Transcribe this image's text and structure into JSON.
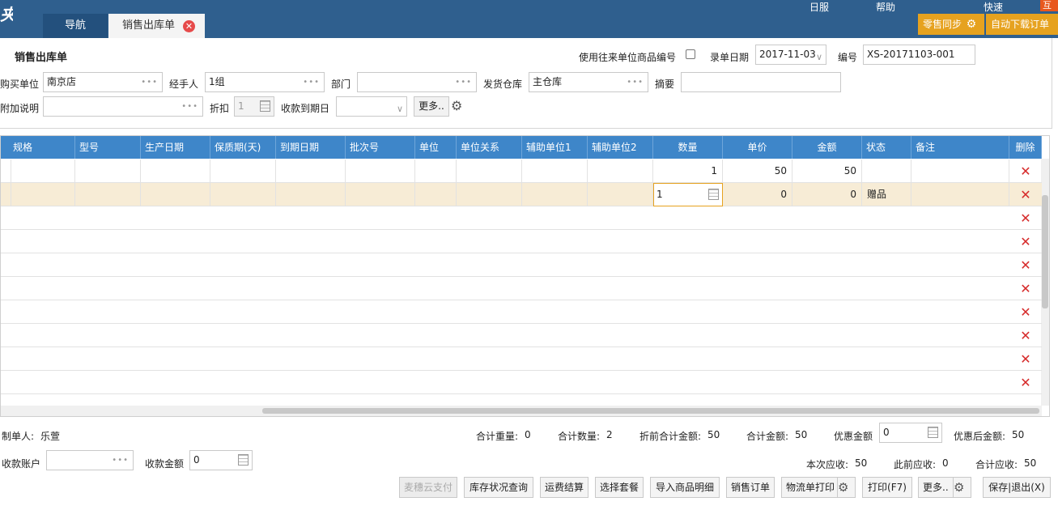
{
  "topbar": {
    "logo_fragment": "夹",
    "menu_fragments": [
      "日服",
      "帮助",
      "快速"
    ],
    "corner_tag": "互动",
    "tabs": [
      {
        "label": "导航"
      },
      {
        "label": "销售出库单"
      }
    ],
    "retail_sync_label": "零售同步",
    "auto_download_label": "自动下载订单"
  },
  "form": {
    "title": "销售出库单",
    "use_partner_code_label": "使用往来单位商品编号",
    "entry_date_label": "录单日期",
    "entry_date_value": "2017-11-03",
    "number_label": "编号",
    "number_value": "XS-20171103-001",
    "buyer_label": "购买单位",
    "buyer_value": "南京店",
    "handler_label": "经手人",
    "handler_value": "1组",
    "dept_label": "部门",
    "dept_value": "",
    "warehouse_label": "发货仓库",
    "warehouse_value": "主仓库",
    "summary_label": "摘要",
    "summary_value": "",
    "note_label": "附加说明",
    "note_value": "",
    "discount_label": "折扣",
    "discount_value": "1",
    "due_label": "收款到期日",
    "due_value": "",
    "more_label": "更多.."
  },
  "grid": {
    "columns": [
      "规格",
      "型号",
      "生产日期",
      "保质期(天)",
      "到期日期",
      "批次号",
      "单位",
      "单位关系",
      "辅助单位1",
      "辅助单位2",
      "数量",
      "单价",
      "金额",
      "状态",
      "备注",
      "删除"
    ],
    "rows": [
      {
        "qty": "1",
        "price": "50",
        "amount": "50",
        "status": ""
      },
      {
        "qty": "1",
        "price": "0",
        "amount": "0",
        "status": "赠品"
      }
    ],
    "delete_glyph": "✕"
  },
  "footer": {
    "maker_label": "制单人:",
    "maker_value": "乐萱",
    "total_weight_label": "合计重量:",
    "total_weight_value": "0",
    "total_qty_label": "合计数量:",
    "total_qty_value": "2",
    "pre_discount_label": "折前合计金额:",
    "pre_discount_value": "50",
    "total_amount_label": "合计金额:",
    "total_amount_value": "50",
    "discount_amount_label": "优惠金额",
    "discount_amount_value": "0",
    "after_discount_label": "优惠后金额:",
    "after_discount_value": "50",
    "account_label": "收款账户",
    "account_value": "",
    "receive_label": "收款金额",
    "receive_value": "0",
    "this_due_label": "本次应收:",
    "this_due_value": "50",
    "prev_due_label": "此前应收:",
    "prev_due_value": "0",
    "total_due_label": "合计应收:",
    "total_due_value": "50",
    "buttons": {
      "cloud_pay": "麦穗云支付",
      "stock_query": "库存状况查询",
      "freight": "运费结算",
      "package": "选择套餐",
      "import_detail": "导入商品明细",
      "sales_order": "销售订单",
      "logistics_print": "物流单打印",
      "print": "打印(F7)",
      "more": "更多..",
      "save_exit": "保存|退出(X)"
    }
  },
  "colors": {
    "topbar": "#2f5f8e",
    "grid_header": "#3e86c9",
    "accent_orange": "#e6a21f",
    "delete_red": "#d62a2a",
    "selected_row": "#f7ecd6"
  }
}
